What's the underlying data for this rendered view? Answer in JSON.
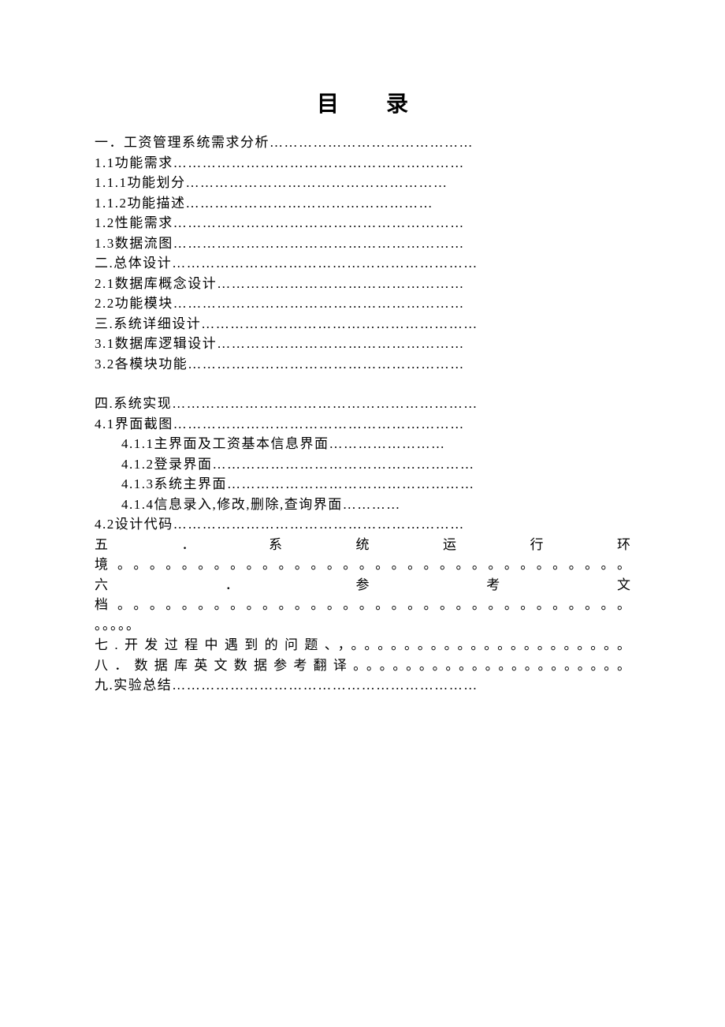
{
  "title": "目录",
  "entries": {
    "e1": "一．工资管理系统需求分析……………………………………",
    "e2": "1.1功能需求……………………………………………………",
    "e3": "1.1.1功能划分………………………………………………",
    "e4": "1.1.2功能描述……………………………………………",
    "e5": "1.2性能需求……………………………………………………",
    "e6": "1.3数据流图……………………………………………………",
    "e7": "二.总体设计………………………………………………………",
    "e8": "2.1数据库概念设计……………………………………………",
    "e9": "2.2功能模块……………………………………………………",
    "e10": "三.系统详细设计…………………………………………………",
    "e11": "3.1数据库逻辑设计……………………………………………",
    "e12": "3.2各模块功能…………………………………………………",
    "e13": "四.系统实现………………………………………………………",
    "e14": "4.1界面截图……………………………………………………",
    "e15": "4.1.1主界面及工资基本信息界面……………………",
    "e16": "4.1.2登录界面………………………………………………",
    "e17": "4.1.3系统主界面……………………………………………",
    "e18": "4.1.4信息录入,修改,删除,查询界面…………",
    "e19": "4.2设计代码……………………………………………………",
    "e20a": "五．系统运行环",
    "e20b": "境。。。。。。。。。。。。。。。。。。。。。。。。。。。。。。。。",
    "e21a": "六．参考文",
    "e21b": "档。。。。。。。。。。。。。。。。。。。。。。。。。。。。。。。。",
    "e21c": "。。。。。",
    "e22": "七.开发过程中遇到的问题、，。。。。。。。。。。。。。。。。。。。。。",
    "e23": "八．数据库英文数据参考翻译。。。。。。。。。。。。。。。。。。。。。",
    "e24": "九.实验总结………………………………………………………"
  }
}
